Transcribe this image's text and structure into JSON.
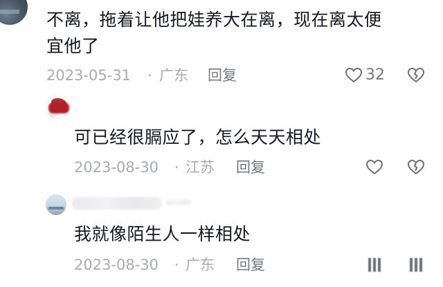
{
  "comments": [
    {
      "text_lines": [
        "不离，拖着让他把娃养大在离，现在离太便",
        "宜他了"
      ],
      "date": "2023-05-31",
      "location": "广东",
      "reply_label": "回复",
      "likes": "32"
    },
    {
      "text_lines": [
        "可已经很膈应了，怎么天天相处"
      ],
      "date": "2023-08-30",
      "location": "江苏",
      "reply_label": "回复"
    },
    {
      "text_lines": [
        "我就像陌生人一样相处"
      ],
      "date": "2023-08-30",
      "location": "广东",
      "reply_label": "回复"
    }
  ],
  "separator": "·",
  "icons": {
    "like": "heart-icon",
    "dislike": "broken-heart-icon"
  }
}
